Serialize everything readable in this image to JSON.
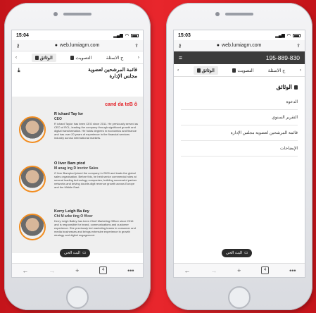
{
  "left": {
    "time": "15:04",
    "url": "web.lumiagm.com",
    "tabs": {
      "back": "‹",
      "questions": "ج الاسئلة",
      "voting": "التصويت",
      "documents": "الوثائق",
      "forward": "›"
    },
    "title_line1": "قائمة المرشحين لعضوية",
    "title_line2": "مجلس الإدارة",
    "doc_header": "cand da teB ô",
    "members": [
      {
        "name": "R ichard Tay lor",
        "role": "CEO",
        "text": "R ichard Taylor has been CEO since 2011. He previously served as CEO of RCL, leading the company through significant growth and digital transformation. He holds degrees in economics and finance and has over 20 years of experience in the financial services industry across international markets."
      },
      {
        "name": "O liver Bam ptod",
        "role": "M anag ing D irector Sales",
        "text": "O liver Bamptod joined the company in 2009 and leads the global sales organisation. Before this, he held senior commercial roles at several leading technology companies, building successful partner networks and driving double-digit revenue growth across Europe and the Middle East."
      },
      {
        "name": "Kerry Leigh Ba iley",
        "role": "Chi M arke ting O fficer",
        "text": "Kerry Leigh Bailey has been Chief Marketing Officer since 2016 and is responsible for brand, communications and customer experience. She previously led marketing teams in consumer and media businesses and brings extensive experience in growth strategy and digital engagement."
      }
    ],
    "pill_label": "البث الحي",
    "tab_count": "4"
  },
  "right": {
    "time": "15:03",
    "url": "web.lumiagm.com",
    "phone_number": "195-889-830",
    "tabs": {
      "back": "‹",
      "questions": "ج الاسئلة",
      "voting": "التصويت",
      "documents": "الوثائق",
      "forward": "›"
    },
    "section_title": "الوثائق",
    "items": [
      "الدعوة",
      "التقرير السنوي",
      "قائمة المرشحين لعضوية مجلس الإدارة",
      "الإيضاحات"
    ],
    "pill_label": "البث الحي",
    "tab_count": "4"
  },
  "colors": {
    "brand_red": "#e31e24",
    "accent_orange": "#f28c1e",
    "dark_bar": "#3b3b3b"
  }
}
